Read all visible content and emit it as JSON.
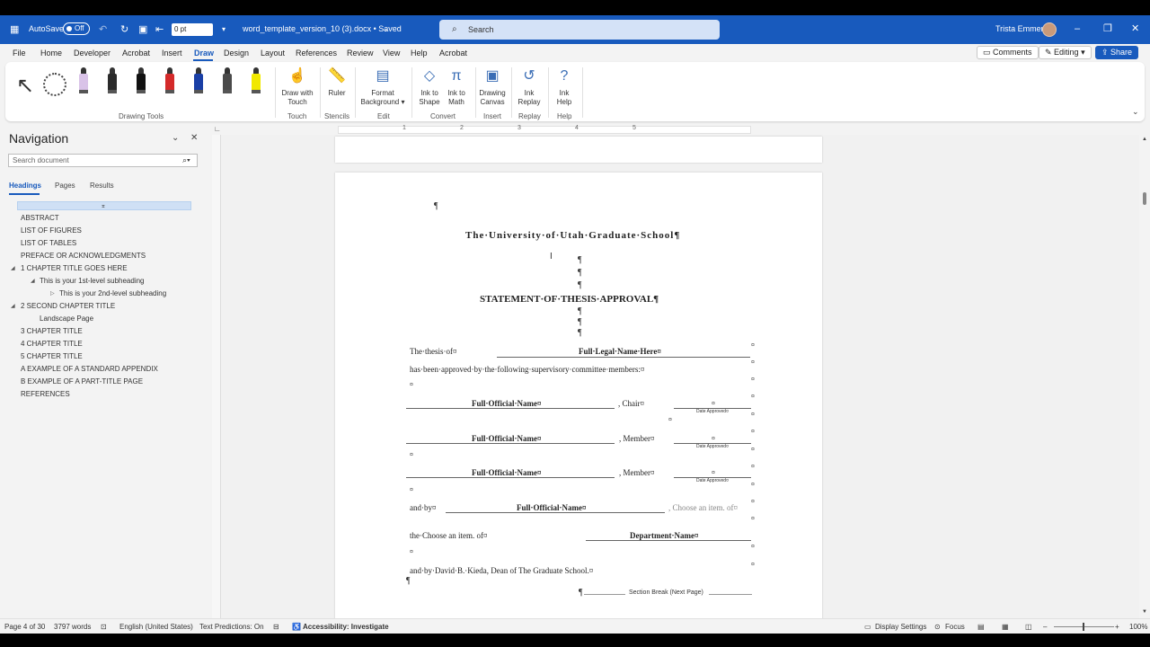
{
  "titlebar": {
    "autosave_label": "AutoSave",
    "autosave_state": "Off",
    "font_size_value": "0 pt",
    "doc_title": "word_template_version_10 (3).docx • Saved",
    "search_placeholder": "Search",
    "user_name": "Trista Emmer"
  },
  "menu": {
    "tabs": [
      "File",
      "Home",
      "Developer",
      "Acrobat",
      "Insert",
      "Draw",
      "Design",
      "Layout",
      "References",
      "Review",
      "View",
      "Help",
      "Acrobat"
    ],
    "active_tab": "Draw",
    "comments_label": "Comments",
    "editing_label": "Editing",
    "share_label": "Share"
  },
  "ribbon": {
    "group_drawing_tools": "Drawing Tools",
    "pen_colors": [
      "#d9c3e8",
      "#2a2a2a",
      "#111111",
      "#d42a2a",
      "#1a3fa6",
      "#4a4a4a",
      "#f1e800"
    ],
    "buttons": [
      {
        "label1": "Draw with",
        "label2": "Touch",
        "group": "Touch"
      },
      {
        "label1": "Ruler",
        "label2": "",
        "group": "Stencils"
      },
      {
        "label1": "Format",
        "label2": "Background",
        "group": "Edit"
      },
      {
        "label1": "Ink to",
        "label2": "Shape",
        "group": "Convert"
      },
      {
        "label1": "Ink to",
        "label2": "Math",
        "group": ""
      },
      {
        "label1": "Drawing",
        "label2": "Canvas",
        "group": "Insert"
      },
      {
        "label1": "Ink",
        "label2": "Replay",
        "group": "Replay"
      },
      {
        "label1": "Ink",
        "label2": "Help",
        "group": "Help"
      }
    ]
  },
  "nav": {
    "title": "Navigation",
    "search_placeholder": "Search document",
    "tabs": [
      "Headings",
      "Pages",
      "Results"
    ],
    "items": [
      "ABSTRACT",
      "LIST OF FIGURES",
      "LIST OF TABLES",
      "PREFACE OR ACKNOWLEDGMENTS",
      "1  CHAPTER TITLE GOES HERE",
      "This is your 1st-level subheading",
      "This is your 2nd-level subheading",
      "2  SECOND CHAPTER TITLE",
      "Landscape Page",
      "3  CHAPTER TITLE",
      "4  CHAPTER TITLE",
      "5  CHAPTER TITLE",
      "A  EXAMPLE OF A STANDARD APPENDIX",
      "B  EXAMPLE OF A PART-TITLE PAGE",
      "REFERENCES"
    ]
  },
  "ruler": {
    "numbers": [
      "1",
      "2",
      "3",
      "4",
      "5"
    ]
  },
  "document": {
    "university": "The·University·of·Utah·Graduate·School¶",
    "statement": "STATEMENT·OF·THESIS·APPROVAL¶",
    "thesis_of": "The·thesis·of¤",
    "legal_name": "Full·Legal·Name·Here¤",
    "approved_by": "has·been·approved·by·the·following·supervisory·committee·members:¤",
    "official_name": "Full·Official·Name¤",
    "chair": ", Chair¤",
    "member": ", Member¤",
    "date_approved": "Date Approved¤",
    "and_by": "and·by¤",
    "choose_item": ", Choose an item. of¤",
    "the_choose": "the·Choose an item. of¤",
    "department": "Department·Name¤",
    "dean_line": "and·by·David·B.·Kieda, Dean of The Graduate School.¤",
    "section_break": "Section Break (Next Page)",
    "pilcrow": "¶",
    "cell_mark": "¤"
  },
  "status": {
    "page": "Page 4 of 30",
    "words": "3797 words",
    "language": "English (United States)",
    "predictions": "Text Predictions: On",
    "accessibility": "Accessibility: Investigate",
    "display": "Display Settings",
    "focus": "Focus",
    "zoom": "100%"
  }
}
